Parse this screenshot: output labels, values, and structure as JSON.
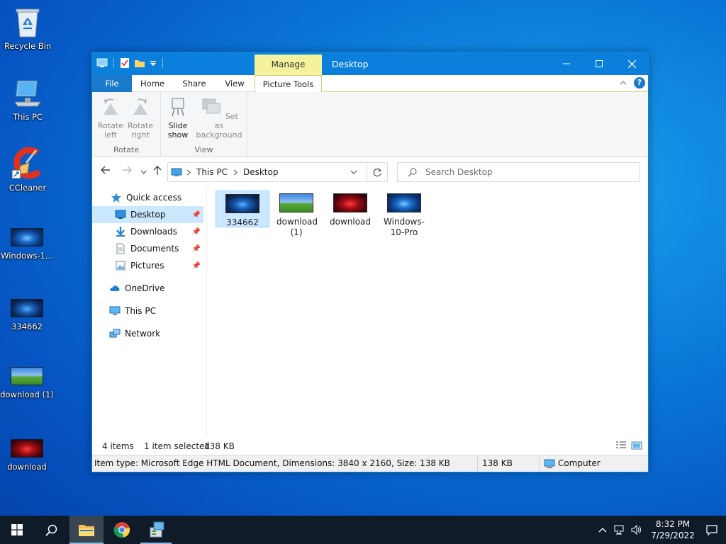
{
  "desktop": {
    "icons": [
      {
        "label": "Recycle Bin"
      },
      {
        "label": "This PC"
      },
      {
        "label": "CCleaner"
      },
      {
        "label": "Windows-1..."
      },
      {
        "label": "334662"
      },
      {
        "label": "download (1)"
      },
      {
        "label": "download"
      }
    ]
  },
  "window": {
    "title": "Desktop",
    "manage_tab": "Manage",
    "tabs": {
      "file": "File",
      "home": "Home",
      "share": "Share",
      "view": "View",
      "picture_tools": "Picture Tools"
    },
    "ribbon": {
      "rotate_left": "Rotate left",
      "rotate_right": "Rotate right",
      "rotate_group": "Rotate",
      "slide_show": "Slide show",
      "set_as_background": "Set as background",
      "view_group": "View"
    },
    "address": {
      "root": "This PC",
      "current": "Desktop"
    },
    "search": {
      "placeholder": "Search Desktop"
    },
    "nav": {
      "quick_access": "Quick access",
      "desktop": "Desktop",
      "downloads": "Downloads",
      "documents": "Documents",
      "pictures": "Pictures",
      "onedrive": "OneDrive",
      "this_pc": "This PC",
      "network": "Network"
    },
    "files": [
      {
        "name": "334662",
        "thumb": "windows-blue",
        "selected": true
      },
      {
        "name": "download (1)",
        "thumb": "bliss",
        "selected": false
      },
      {
        "name": "download",
        "thumb": "windows-red",
        "selected": false
      },
      {
        "name": "Windows-10-Pro",
        "thumb": "windows-blue",
        "selected": false
      }
    ],
    "status": {
      "items": "4 items",
      "selected": "1 item selected",
      "size": "138 KB"
    },
    "details": {
      "info": "Item type: Microsoft Edge HTML Document, Dimensions: 3840 x 2160, Size: 138 KB",
      "size": "138 KB",
      "location": "Computer"
    }
  },
  "taskbar": {
    "time": "8:32 PM",
    "date": "7/29/2022"
  },
  "colors": {
    "titlebar": "#0a7fdc",
    "manage_tab": "#f4f29c",
    "selection": "#cce8ff",
    "taskbar": "#101b2a"
  }
}
